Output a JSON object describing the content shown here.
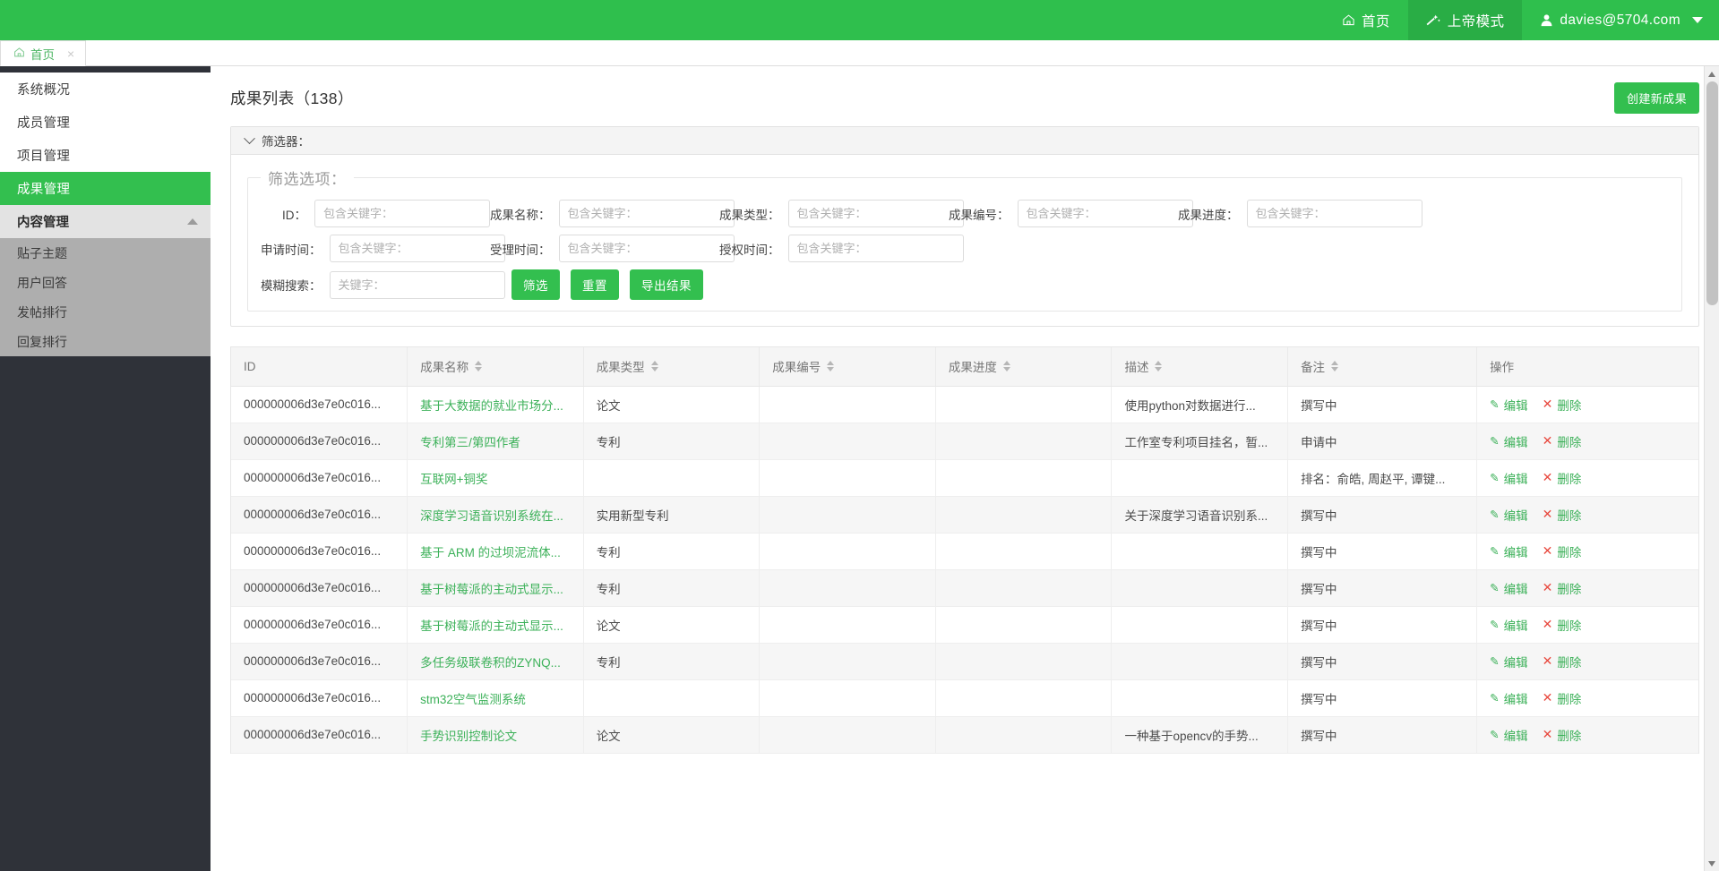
{
  "topbar": {
    "items": [
      {
        "label": "首页",
        "icon": "home-icon",
        "active": false
      },
      {
        "label": "上帝模式",
        "icon": "magic-wand-icon",
        "active": true
      }
    ],
    "user": {
      "label": "davies@5704.com",
      "icon": "user-icon"
    },
    "accent": "#2fbf4d",
    "accent_active": "#29ad45"
  },
  "tabs": [
    {
      "label": "首页",
      "icon": "home-icon",
      "close": "×"
    }
  ],
  "sidebar": {
    "items": [
      {
        "label": "系统概况",
        "type": "item",
        "active": false
      },
      {
        "label": "成员管理",
        "type": "item",
        "active": false
      },
      {
        "label": "项目管理",
        "type": "item",
        "active": false
      },
      {
        "label": "成果管理",
        "type": "item",
        "active": true
      },
      {
        "label": "内容管理",
        "type": "group",
        "expanded": true
      },
      {
        "label": "贴子主题",
        "type": "sub"
      },
      {
        "label": "用户回答",
        "type": "sub"
      },
      {
        "label": "发帖排行",
        "type": "sub"
      },
      {
        "label": "回复排行",
        "type": "sub"
      }
    ]
  },
  "page": {
    "title": "成果列表（138）",
    "count": 138,
    "create_button": "创建新成果"
  },
  "filter_panel": {
    "header_label": "筛选器：",
    "legend": "筛选选项：",
    "rows": [
      [
        {
          "label": "ID：",
          "placeholder": "包含关键字：",
          "value": "",
          "name": "id"
        },
        {
          "label": "成果名称：",
          "placeholder": "包含关键字：",
          "value": "",
          "name": "achievement-name"
        },
        {
          "label": "成果类型：",
          "placeholder": "包含关键字：",
          "value": "",
          "name": "achievement-type"
        },
        {
          "label": "成果编号：",
          "placeholder": "包含关键字：",
          "value": "",
          "name": "achievement-number"
        },
        {
          "label": "成果进度：",
          "placeholder": "包含关键字：",
          "value": "",
          "name": "achievement-progress"
        }
      ],
      [
        {
          "label": "申请时间：",
          "placeholder": "包含关键字：",
          "value": "",
          "name": "apply-time"
        },
        {
          "label": "受理时间：",
          "placeholder": "包含关键字：",
          "value": "",
          "name": "accept-time"
        },
        {
          "label": "授权时间：",
          "placeholder": "包含关键字：",
          "value": "",
          "name": "grant-time"
        }
      ]
    ],
    "fuzzy": {
      "label": "模糊搜索：",
      "placeholder": "关键字：",
      "value": ""
    },
    "buttons": [
      {
        "label": "筛选",
        "name": "filter-button"
      },
      {
        "label": "重置",
        "name": "reset-button"
      },
      {
        "label": "导出结果",
        "name": "export-button"
      }
    ]
  },
  "table": {
    "columns": [
      {
        "label": "ID",
        "sortable": false
      },
      {
        "label": "成果名称",
        "sortable": true
      },
      {
        "label": "成果类型",
        "sortable": true
      },
      {
        "label": "成果编号",
        "sortable": true
      },
      {
        "label": "成果进度",
        "sortable": true
      },
      {
        "label": "描述",
        "sortable": true
      },
      {
        "label": "备注",
        "sortable": true
      },
      {
        "label": "操作",
        "sortable": false
      }
    ],
    "row_actions": {
      "edit": "编辑",
      "delete": "删除"
    },
    "rows": [
      {
        "id": "000000006d3e7e0c016...",
        "name": "基于大数据的就业市场分...",
        "type": "论文",
        "number": "",
        "progress": "",
        "description": "使用python对数据进行...",
        "remark": "撰写中"
      },
      {
        "id": "000000006d3e7e0c016...",
        "name": "专利第三/第四作者",
        "type": "专利",
        "number": "",
        "progress": "",
        "description": "工作室专利项目挂名，暂...",
        "remark": "申请中"
      },
      {
        "id": "000000006d3e7e0c016...",
        "name": "互联网+铜奖",
        "type": "",
        "number": "",
        "progress": "",
        "description": "",
        "remark": "排名：俞皓, 周赵平, 谭键..."
      },
      {
        "id": "000000006d3e7e0c016...",
        "name": "深度学习语音识别系统在...",
        "type": "实用新型专利",
        "number": "",
        "progress": "",
        "description": "关于深度学习语音识别系...",
        "remark": "撰写中"
      },
      {
        "id": "000000006d3e7e0c016...",
        "name": "基于 ARM 的过坝泥流体...",
        "type": "专利",
        "number": "",
        "progress": "",
        "description": "",
        "remark": "撰写中"
      },
      {
        "id": "000000006d3e7e0c016...",
        "name": "基于树莓派的主动式显示...",
        "type": "专利",
        "number": "",
        "progress": "",
        "description": "",
        "remark": "撰写中"
      },
      {
        "id": "000000006d3e7e0c016...",
        "name": "基于树莓派的主动式显示...",
        "type": "论文",
        "number": "",
        "progress": "",
        "description": "",
        "remark": "撰写中"
      },
      {
        "id": "000000006d3e7e0c016...",
        "name": "多任务级联卷积的ZYNQ...",
        "type": "专利",
        "number": "",
        "progress": "",
        "description": "",
        "remark": "撰写中"
      },
      {
        "id": "000000006d3e7e0c016...",
        "name": "stm32空气监测系统",
        "type": "",
        "number": "",
        "progress": "",
        "description": "",
        "remark": "撰写中"
      },
      {
        "id": "000000006d3e7e0c016...",
        "name": "手势识别控制论文",
        "type": "论文",
        "number": "",
        "progress": "",
        "description": "一种基于opencv的手势...",
        "remark": "撰写中"
      }
    ]
  }
}
